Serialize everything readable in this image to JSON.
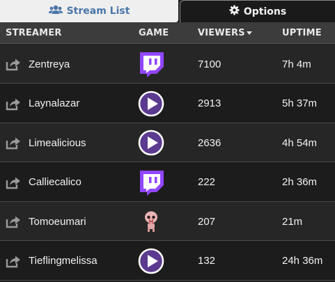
{
  "tabs": {
    "stream_list": "Stream List",
    "options": "Options"
  },
  "columns": {
    "streamer": "STREAMER",
    "game": "GAME",
    "viewers": "VIEWERS",
    "uptime": "UPTIME"
  },
  "colors": {
    "twitch_purple": "#9146ff",
    "play_purple": "#5b3a8f",
    "tab_active_text": "#4a76a8"
  },
  "rows": [
    {
      "name": "Zentreya",
      "game_icon": "twitch-icon",
      "viewers": "7100",
      "uptime": "7h 4m"
    },
    {
      "name": "Laynalazar",
      "game_icon": "play-icon",
      "viewers": "2913",
      "uptime": "5h 37m"
    },
    {
      "name": "Limealicious",
      "game_icon": "play-icon",
      "viewers": "2636",
      "uptime": "4h 54m"
    },
    {
      "name": "Calliecalico",
      "game_icon": "twitch-icon",
      "viewers": "222",
      "uptime": "2h 36m"
    },
    {
      "name": "Tomoeumari",
      "game_icon": "isaac-icon",
      "viewers": "207",
      "uptime": "21m"
    },
    {
      "name": "Tieflingmelissa",
      "game_icon": "play-icon",
      "viewers": "132",
      "uptime": "24h 36m"
    }
  ]
}
